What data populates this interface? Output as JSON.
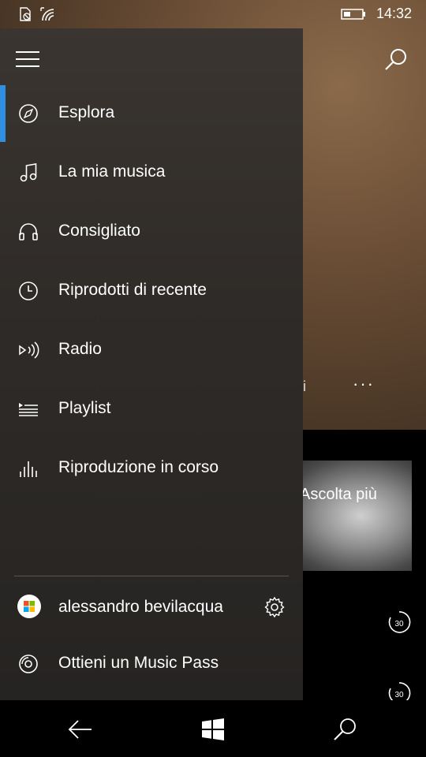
{
  "status_bar": {
    "time": "14:32"
  },
  "drawer": {
    "items": [
      {
        "label": "Esplora",
        "icon": "compass-icon",
        "active": true
      },
      {
        "label": "La mia musica",
        "icon": "music-note-icon"
      },
      {
        "label": "Consigliato",
        "icon": "headphones-icon"
      },
      {
        "label": "Riprodotti di recente",
        "icon": "clock-icon"
      },
      {
        "label": "Radio",
        "icon": "radio-icon"
      },
      {
        "label": "Playlist",
        "icon": "playlist-icon"
      },
      {
        "label": "Riproduzione in corso",
        "icon": "equalizer-icon"
      }
    ],
    "account": {
      "name": "alessandro bevilacqua"
    },
    "music_pass": {
      "label": "Ottieni un Music Pass"
    }
  },
  "background": {
    "card_text": "Ascolta più",
    "partial_text": "li",
    "more": "···",
    "skip_label": "30"
  },
  "colors": {
    "accent": "#2f8fe0",
    "drawer_bg": "#2f2b28"
  }
}
